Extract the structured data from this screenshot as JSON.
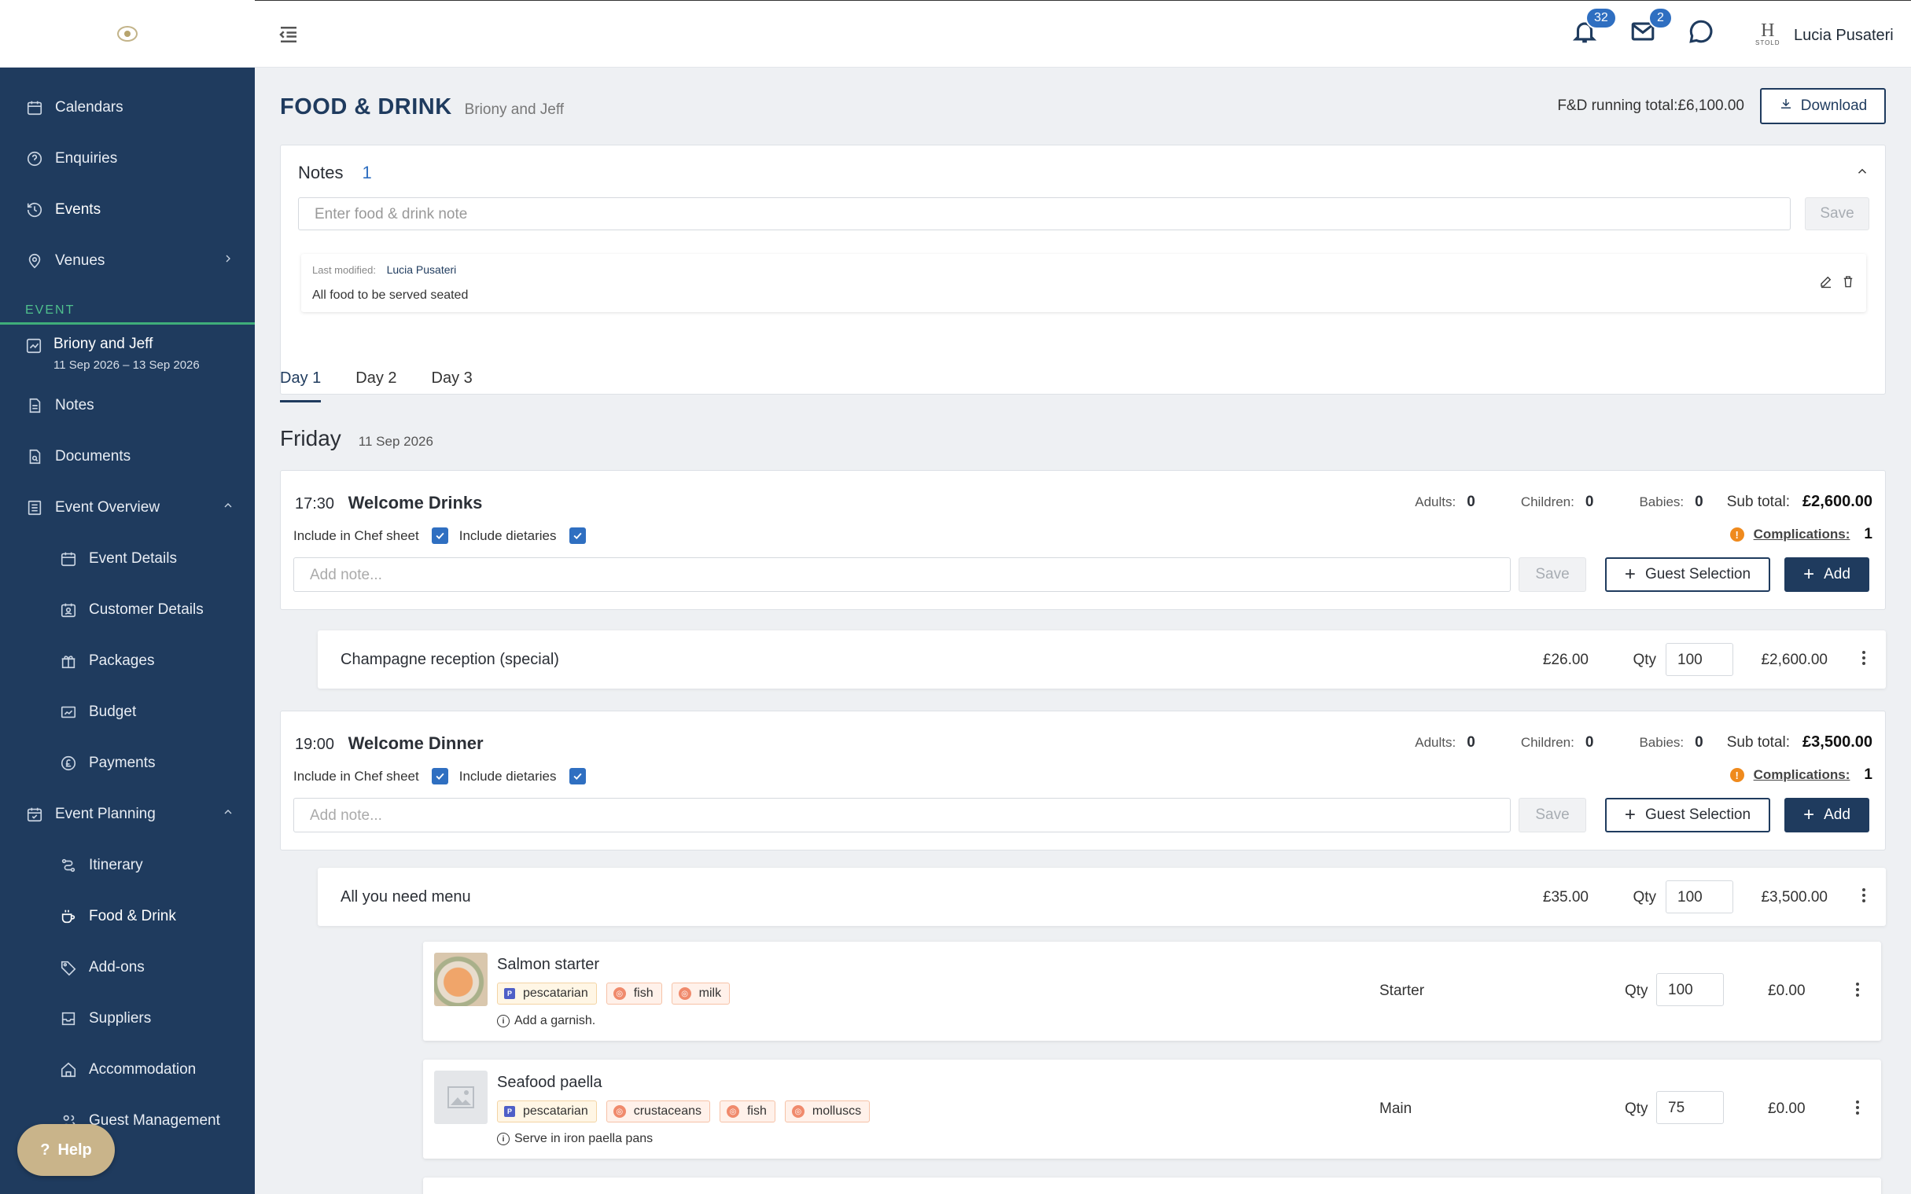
{
  "sidebar": {
    "items": [
      {
        "label": "Calendars",
        "icon": "calendar-icon"
      },
      {
        "label": "Enquiries",
        "icon": "question-circle-icon"
      },
      {
        "label": "Events",
        "icon": "history-icon"
      },
      {
        "label": "Venues",
        "icon": "location-pin-icon"
      }
    ],
    "section_label": "EVENT",
    "event": {
      "title": "Briony and Jeff",
      "dates": "11 Sep 2026 – 13 Sep 2026"
    },
    "event_items": [
      {
        "label": "Notes"
      },
      {
        "label": "Documents"
      },
      {
        "label": "Event Overview"
      },
      {
        "label": "Event Details"
      },
      {
        "label": "Customer Details"
      },
      {
        "label": "Packages"
      },
      {
        "label": "Budget"
      },
      {
        "label": "Payments"
      },
      {
        "label": "Event Planning"
      },
      {
        "label": "Itinerary"
      },
      {
        "label": "Food & Drink"
      },
      {
        "label": "Add-ons"
      },
      {
        "label": "Suppliers"
      },
      {
        "label": "Accommodation"
      },
      {
        "label": "Guest Management"
      }
    ],
    "help_label": "Help"
  },
  "topbar": {
    "notifications_count": "32",
    "mail_count": "2",
    "hotel_logo": "H",
    "hotel_logo_small": "STOLD",
    "user_name": "Lucia Pusateri"
  },
  "page": {
    "title": "FOOD & DRINK",
    "subtitle": "Briony and Jeff",
    "running_total": "F&D running total:£6,100.00",
    "download_label": "Download"
  },
  "notes": {
    "title": "Notes",
    "count": "1",
    "input_placeholder": "Enter food & drink note",
    "save_label": "Save",
    "entry": {
      "meta_label": "Last modified:",
      "author": "Lucia Pusateri",
      "text": "All food to be served seated"
    }
  },
  "tabs": [
    "Day 1",
    "Day 2",
    "Day 3"
  ],
  "day": {
    "name": "Friday",
    "date": "11 Sep 2026"
  },
  "labels": {
    "adults": "Adults:",
    "children": "Children:",
    "babies": "Babies:",
    "subtotal": "Sub total:",
    "include_chef": "Include in Chef sheet",
    "include_dietaries": "Include dietaries",
    "complications": "Complications:",
    "add_note_placeholder": "Add note...",
    "save": "Save",
    "guest_selection": "Guest Selection",
    "add": "Add",
    "qty": "Qty"
  },
  "events": [
    {
      "time": "17:30",
      "name": "Welcome Drinks",
      "adults": "0",
      "children": "0",
      "babies": "0",
      "subtotal": "£2,600.00",
      "complications": "1",
      "line": {
        "name": "Champagne reception (special)",
        "price": "£26.00",
        "qty": "100",
        "total": "£2,600.00"
      }
    },
    {
      "time": "19:00",
      "name": "Welcome Dinner",
      "adults": "0",
      "children": "0",
      "babies": "0",
      "subtotal": "£3,500.00",
      "complications": "1",
      "line": {
        "name": "All you need menu",
        "price": "£35.00",
        "qty": "100",
        "total": "£3,500.00"
      }
    }
  ],
  "dishes": [
    {
      "name": "Salmon starter",
      "tags": [
        {
          "label": "pescatarian",
          "kind": "diet"
        },
        {
          "label": "fish",
          "kind": "allergen"
        },
        {
          "label": "milk",
          "kind": "allergen"
        }
      ],
      "hint": "Add a garnish.",
      "course": "Starter",
      "qty": "100",
      "total": "£0.00"
    },
    {
      "name": "Seafood paella",
      "tags": [
        {
          "label": "pescatarian",
          "kind": "diet"
        },
        {
          "label": "crustaceans",
          "kind": "allergen"
        },
        {
          "label": "fish",
          "kind": "allergen"
        },
        {
          "label": "molluscs",
          "kind": "allergen"
        }
      ],
      "hint": "Serve in iron paella pans",
      "course": "Main",
      "qty": "75",
      "total": "£0.00"
    }
  ]
}
